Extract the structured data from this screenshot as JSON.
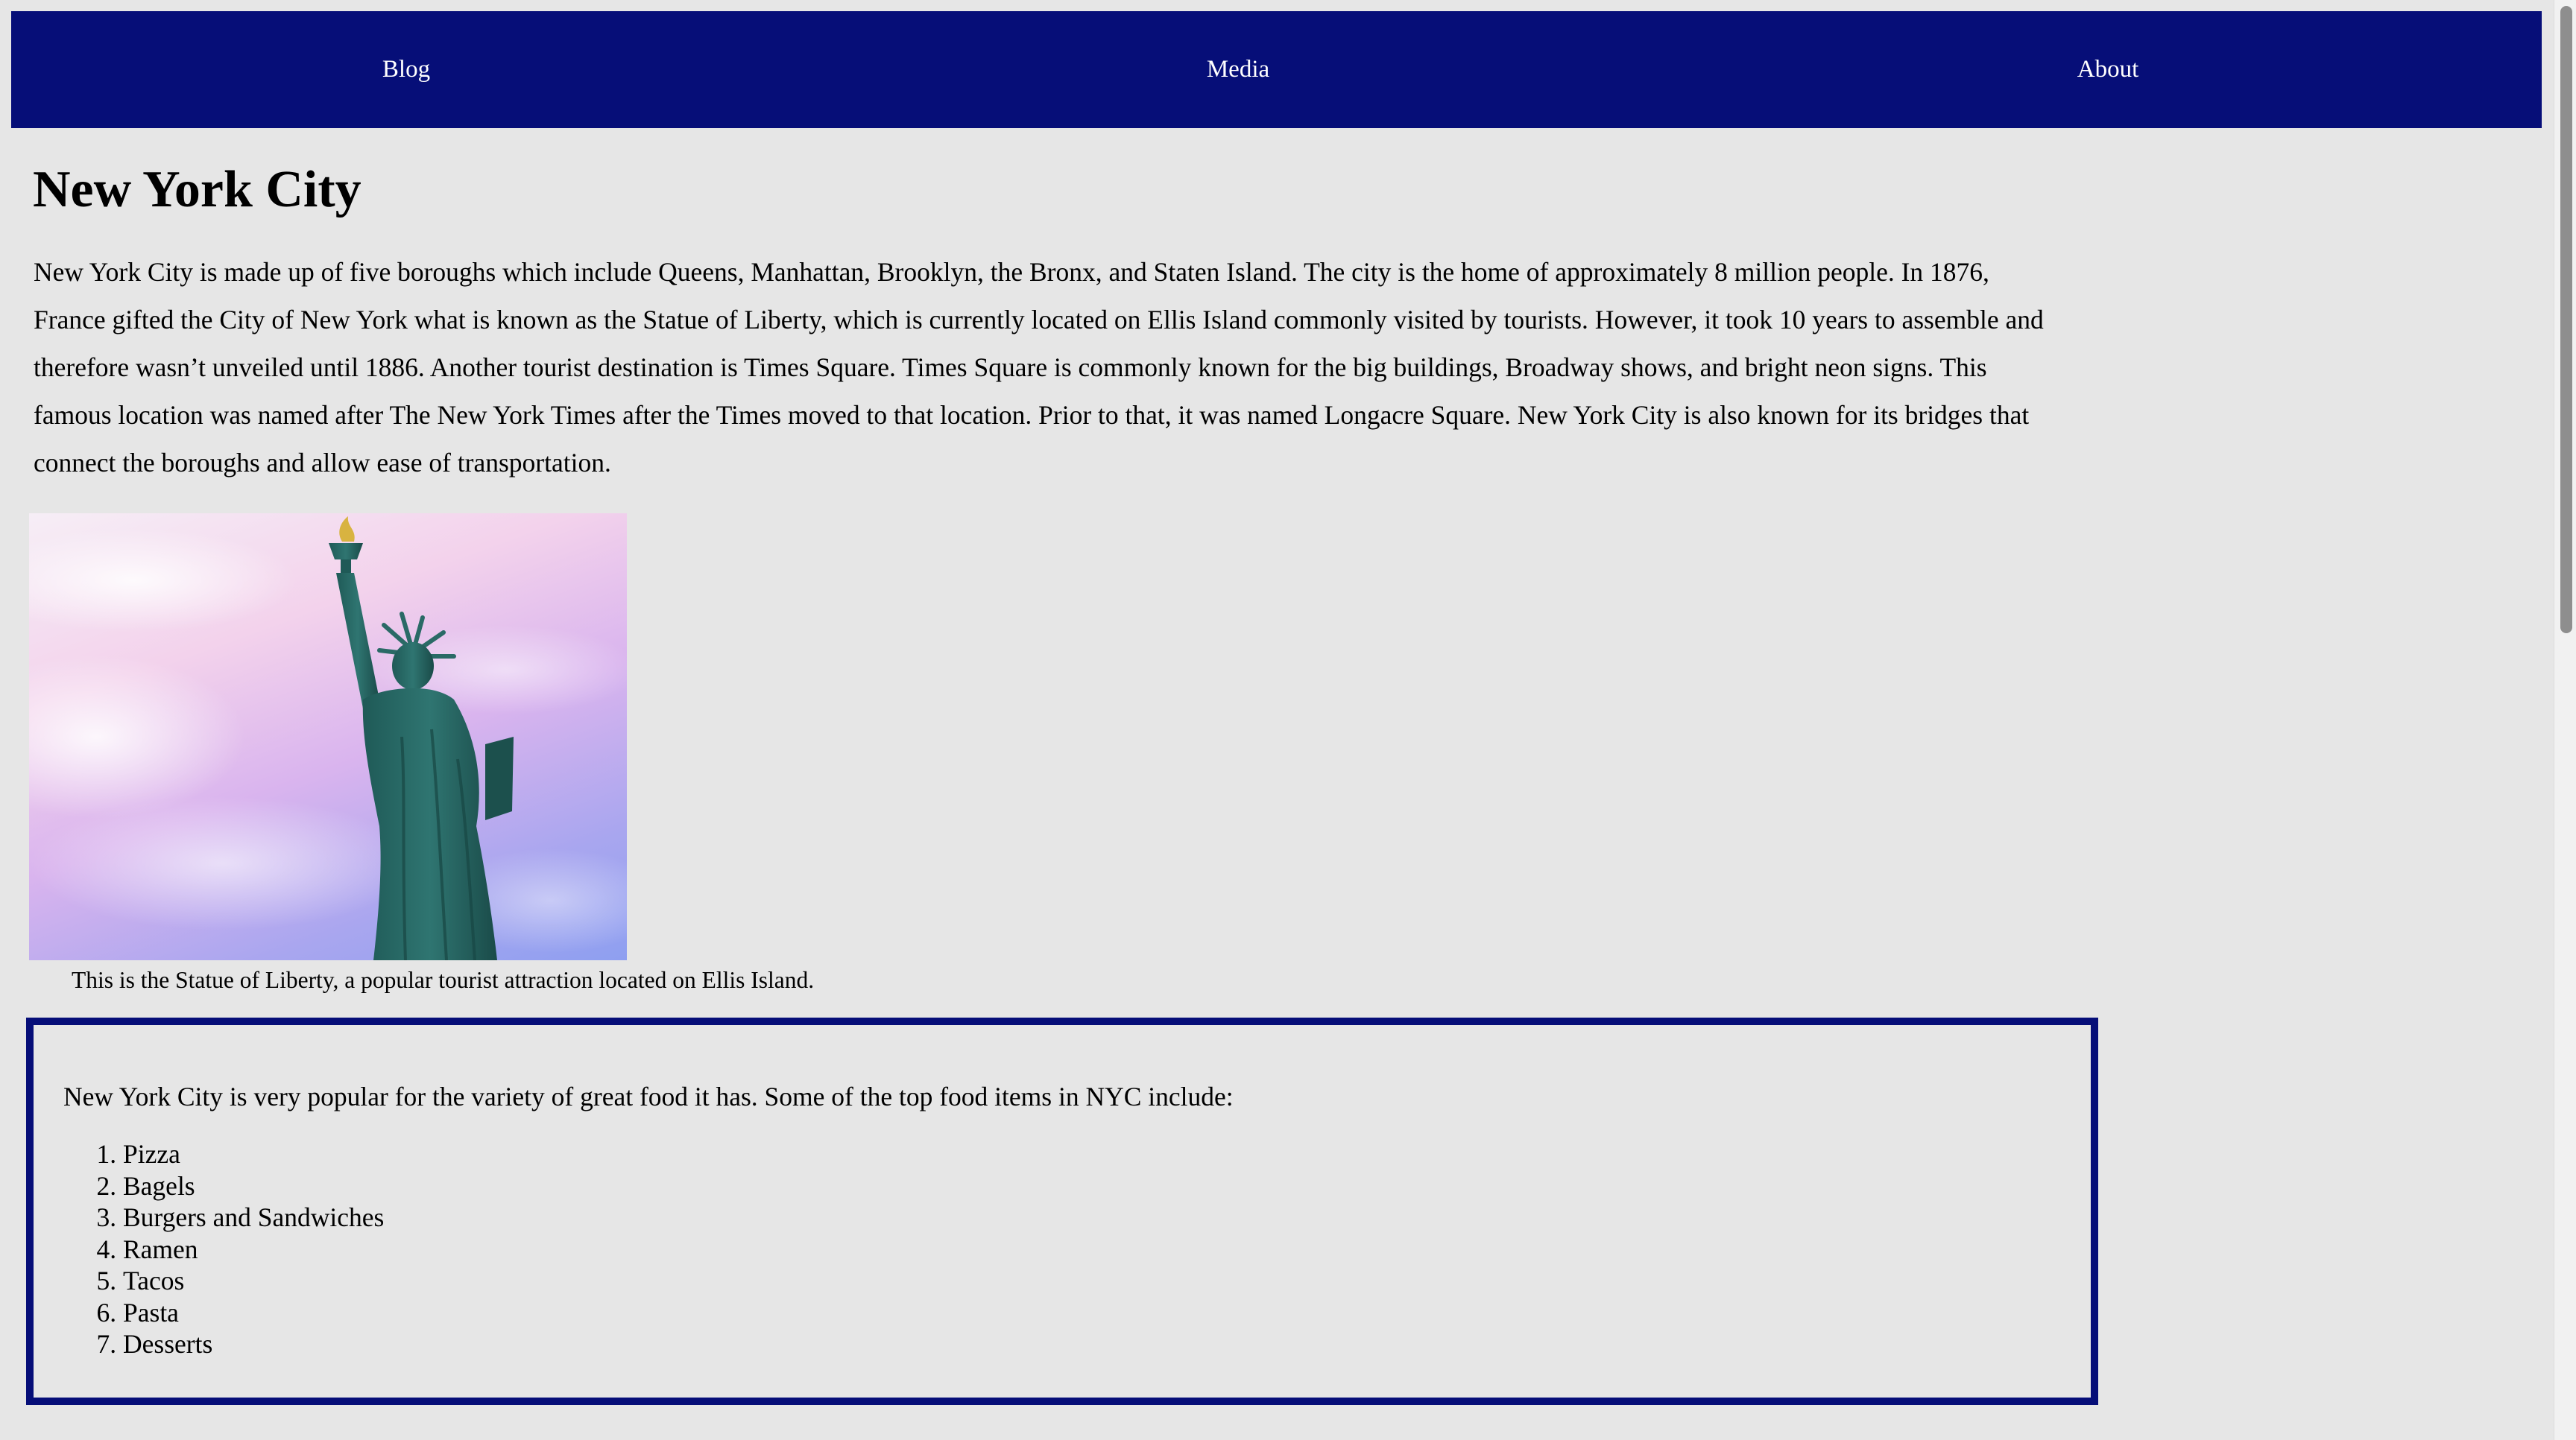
{
  "nav": {
    "items": [
      {
        "label": "Blog"
      },
      {
        "label": "Media"
      },
      {
        "label": "About"
      }
    ],
    "background_color": "#060e78",
    "text_color": "#ffffff"
  },
  "page": {
    "background_color": "#e6e6e6",
    "title": "New York City",
    "intro": "New York City is made up of five boroughs which include Queens, Manhattan, Brooklyn, the Bronx, and Staten Island. The city is the home of approximately 8 million people. In 1876, France gifted the City of New York what is known as the Statue of Liberty, which is currently located on Ellis Island commonly visited by tourists. However, it took 10 years to assemble and therefore wasn’t unveiled until 1886. Another tourist destination is Times Square. Times Square is commonly known for the big buildings, Broadway shows, and bright neon signs. This famous location was named after The New York Times after the Times moved to that location. Prior to that, it was named Longacre Square. New York City is also known for its bridges that connect the boroughs and allow ease of transportation."
  },
  "figure": {
    "image_subject": "statue-of-liberty",
    "caption": "This is the Statue of Liberty, a popular tourist attraction located on Ellis Island."
  },
  "food": {
    "border_color": "#060e78",
    "intro": "New York City is very popular for the variety of great food it has. Some of the top food items in NYC include:",
    "items": [
      "Pizza",
      "Bagels",
      "Burgers and Sandwiches",
      "Ramen",
      "Tacos",
      "Pasta",
      "Desserts"
    ]
  }
}
